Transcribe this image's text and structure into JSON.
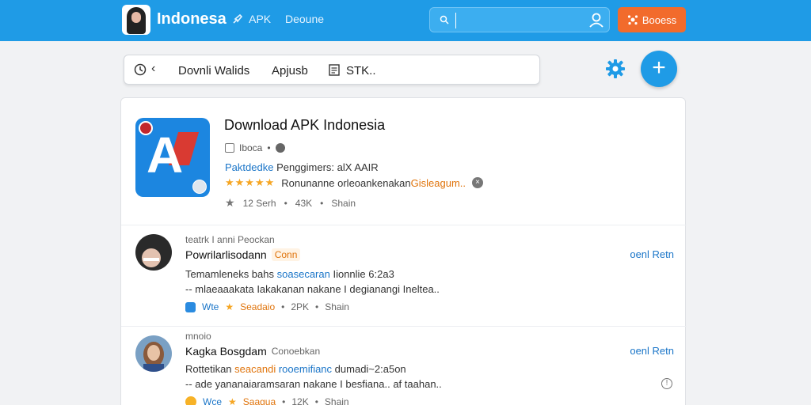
{
  "header": {
    "brand": "Indonesa",
    "nav_apk": "APK",
    "nav_device": "Deoune",
    "search_value": "",
    "action_button": "Booess",
    "brand_color": "#1f9be6",
    "action_color": "#f26b2c"
  },
  "toolbar": {
    "back_icon": "chevron-left-icon",
    "item1": "Dovnli Walids",
    "item2": "Apjusb",
    "item3": "STK..",
    "add_icon": "+"
  },
  "app": {
    "title": "Download APK Indonesia",
    "meta": "Iboca",
    "dev_label": "Paktdedke",
    "dev_text": "Penggimers: alX AAIR",
    "rating_text": "Ronunanne orleoankenakan",
    "rating_link": "Gisleagum..",
    "stars": "★★★★★",
    "stat1": "12 Serh",
    "stat2": "43K",
    "stat3": "Shain"
  },
  "reviews": [
    {
      "sub": "teatrk I anni Peockan",
      "name": "Powrilarlisodann",
      "tag": "Conn",
      "line1_a": "Temamleneks bahs",
      "line1_b": "soasecaran",
      "line1_c": "Iionnlie 6:2a3",
      "line2": "-- mlaeaaakata Iakakanan nakane I degianangi Ineltea..",
      "foot1": "Wte",
      "foot2": "Seadaio",
      "foot3": "2PK",
      "foot4": "Shain",
      "action": "oenl Retn"
    },
    {
      "sub": "mnoio",
      "name": "Kagka Bosgdam",
      "tag": "Conoebkan",
      "line1_a": "Rottetikan",
      "line1_b": "seacandi",
      "line1_c": "rooemifianc",
      "line1_d": "dumadi~2:a5on",
      "line2": "-- ade yananaiaramsaran nakane I besfiana.. af taahan..",
      "foot1": "Wce",
      "foot2": "Saagua",
      "foot3": "12K",
      "foot4": "Shain",
      "action": "oenl Retn"
    }
  ]
}
